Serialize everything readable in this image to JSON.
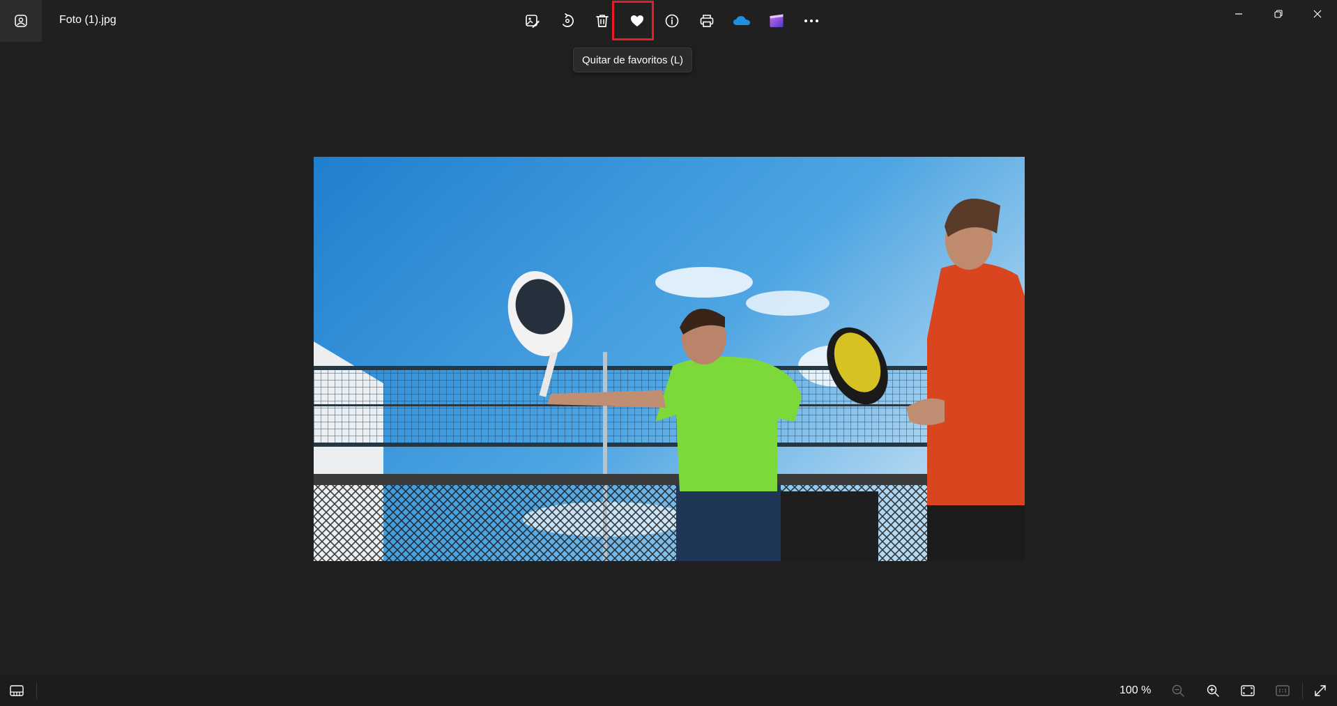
{
  "window": {
    "file_name": "Foto (1).jpg"
  },
  "toolbar": {
    "items": [
      {
        "name": "edit-image",
        "icon": "edit-image-icon"
      },
      {
        "name": "rotate",
        "icon": "rotate-icon"
      },
      {
        "name": "delete",
        "icon": "trash-icon"
      },
      {
        "name": "favorite",
        "icon": "heart-icon",
        "active": true
      },
      {
        "name": "file-info",
        "icon": "info-icon"
      },
      {
        "name": "print",
        "icon": "printer-icon"
      },
      {
        "name": "onedrive",
        "icon": "cloud-icon"
      },
      {
        "name": "clipchamp",
        "icon": "clipchamp-icon"
      },
      {
        "name": "more",
        "icon": "more-icon"
      }
    ],
    "tooltip": "Quitar de favoritos (L)"
  },
  "window_controls": [
    "minimize-icon",
    "restore-icon",
    "close-icon"
  ],
  "statusbar": {
    "zoom_label": "100 %"
  },
  "colors": {
    "background": "#202020",
    "highlight": "#e81c24",
    "onedrive": "#1e90e0",
    "clipchamp": "#7a4fd8"
  }
}
